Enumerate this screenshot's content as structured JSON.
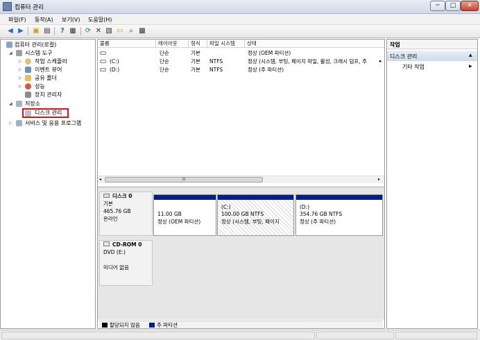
{
  "window": {
    "title": "컴퓨터 관리",
    "min": "─",
    "max": "□",
    "close": "✕"
  },
  "menu": [
    "파일(F)",
    "동작(A)",
    "보기(V)",
    "도움말(H)"
  ],
  "toolbar_icons": [
    "back-arrow",
    "forward-arrow",
    "up-folder",
    "show-tree",
    "help",
    "console-tree",
    "refresh",
    "delete",
    "properties",
    "open",
    "search",
    "disk-settings"
  ],
  "tree": {
    "root": "컴퓨터 관리(로컬)",
    "system_tools": "시스템 도구",
    "task_scheduler": "작업 스케줄러",
    "event_viewer": "이벤트 뷰어",
    "shared_folders": "공유 폴더",
    "performance": "성능",
    "device_manager": "장치 관리자",
    "storage": "저장소",
    "disk_management": "디스크 관리",
    "services_apps": "서비스 및 응용 프로그램"
  },
  "volume_table": {
    "headers": [
      "볼륨",
      "레이아웃",
      "형식",
      "파일 시스템",
      "상태"
    ],
    "rows": [
      {
        "volume": "",
        "layout": "단순",
        "type": "기본",
        "fs": "",
        "status": "정상 (OEM 파티션)"
      },
      {
        "volume": "(C:)",
        "layout": "단순",
        "type": "기본",
        "fs": "NTFS",
        "status": "정상 (시스템, 부팅, 페이지 파일, 활성, 크래시 덤프, 주"
      },
      {
        "volume": "(D:)",
        "layout": "단순",
        "type": "기본",
        "fs": "NTFS",
        "status": "정상 (주 파티션)"
      }
    ],
    "scroll_grip": "III",
    "more_arrow": "▸"
  },
  "disks": [
    {
      "name": "디스크 0",
      "kind": "기본",
      "size": "465.76 GB",
      "state": "온라인",
      "partitions": [
        {
          "label": "",
          "size": "11.00 GB",
          "status": "정상 (OEM 파티션)"
        },
        {
          "label": "(C:)",
          "size": "100.00 GB NTFS",
          "status": "정상 (시스템, 부팅, 페이지"
        },
        {
          "label": "(D:)",
          "size": "354.76 GB NTFS",
          "status": "정상 (주 파티션)"
        }
      ]
    },
    {
      "name": "CD-ROM 0",
      "kind": "DVD (E:)",
      "state": "미디어 없음"
    }
  ],
  "legend": {
    "unallocated": "할당되지 않음",
    "primary": "주 파티션",
    "unallocated_color": "#000000",
    "primary_color": "#001e8e"
  },
  "actions": {
    "title": "작업",
    "group": "디스크 관리",
    "group_arrow": "▲",
    "item": "기타 작업",
    "item_arrow": "▶"
  },
  "colors": {
    "highlight_box": "#e01010",
    "partition_bar": "#001e8e"
  }
}
